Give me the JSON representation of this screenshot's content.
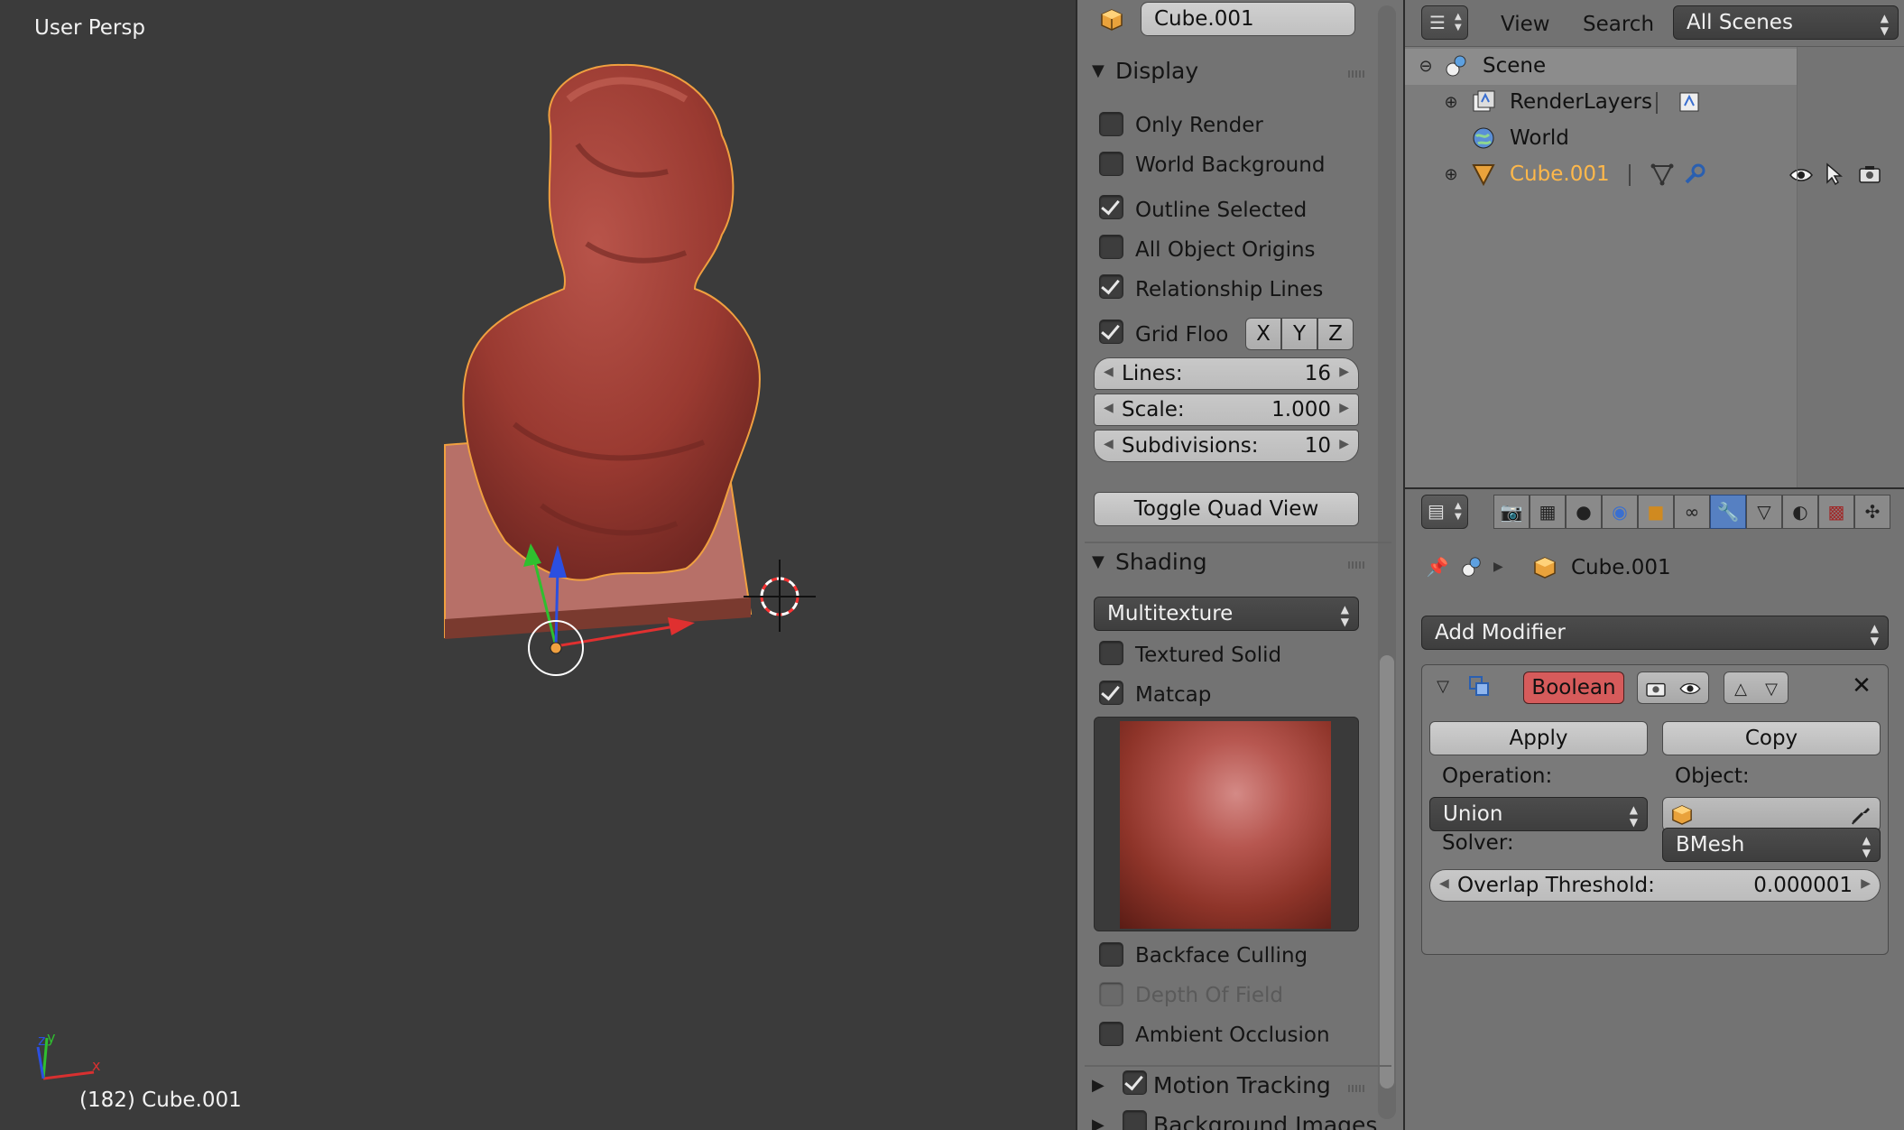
{
  "viewport": {
    "view_label": "User Persp",
    "status": "(182) Cube.001",
    "axis_labels": {
      "x": "x",
      "y": "y",
      "z": "z"
    }
  },
  "npanel": {
    "object_name": "Cube.001",
    "display": {
      "title": "Display",
      "checks": [
        {
          "label": "Only Render",
          "checked": false
        },
        {
          "label": "World Background",
          "checked": false
        },
        {
          "label": "Outline Selected",
          "checked": true
        },
        {
          "label": "All Object Origins",
          "checked": false
        },
        {
          "label": "Relationship Lines",
          "checked": true
        },
        {
          "label": "Grid Floo",
          "checked": true
        }
      ],
      "axes": [
        "X",
        "Y",
        "Z"
      ],
      "lines": {
        "label": "Lines:",
        "value": "16"
      },
      "scale": {
        "label": "Scale:",
        "value": "1.000"
      },
      "subdivisions": {
        "label": "Subdivisions:",
        "value": "10"
      },
      "toggle_quad": "Toggle Quad View"
    },
    "shading": {
      "title": "Shading",
      "mode": "Multitexture",
      "textured_solid": "Textured Solid",
      "matcap": "Matcap",
      "backface": "Backface Culling",
      "dof": "Depth Of Field",
      "ao": "Ambient Occlusion"
    },
    "motion_tracking": "Motion Tracking",
    "background_images": "Background Images"
  },
  "outliner": {
    "view": "View",
    "search": "Search",
    "scenes": "All Scenes",
    "scene": "Scene",
    "renderlayers": "RenderLayers",
    "world": "World",
    "cube": "Cube.001"
  },
  "properties": {
    "breadcrumb": "Cube.001",
    "add_modifier": "Add Modifier",
    "modifier_name": "Boolean",
    "apply": "Apply",
    "copy": "Copy",
    "operation_label": "Operation:",
    "operation": "Union",
    "object_label": "Object:",
    "solver_label": "Solver:",
    "solver": "BMesh",
    "overlap_label": "Overlap Threshold:",
    "overlap_value": "0.000001"
  },
  "colors": {
    "accent": "#5680c2",
    "model": "#b0463a",
    "boolean_btn": "#d65b5b"
  }
}
